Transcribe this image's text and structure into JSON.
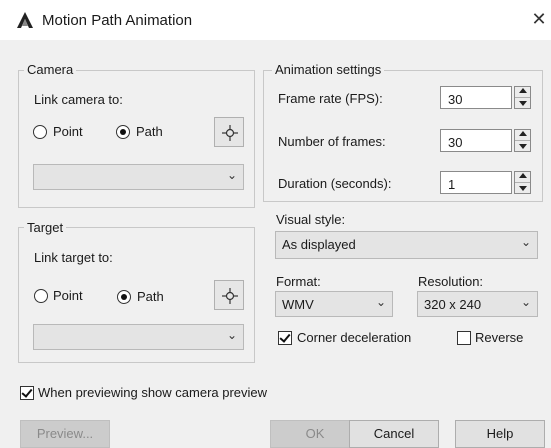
{
  "window": {
    "title": "Motion Path Animation",
    "close_glyph": "✕",
    "app_icon": "autocad-a-icon"
  },
  "camera": {
    "legend": "Camera",
    "link_label": "Link camera to:",
    "options": [
      "Point",
      "Path"
    ],
    "selected": "Path",
    "dropdown_value": ""
  },
  "target": {
    "legend": "Target",
    "link_label": "Link target to:",
    "options": [
      "Point",
      "Path"
    ],
    "selected": "Path",
    "dropdown_value": ""
  },
  "animation": {
    "legend": "Animation settings",
    "frame_rate_label": "Frame rate (FPS):",
    "frame_rate": "30",
    "frames_label": "Number of frames:",
    "frames": "30",
    "duration_label": "Duration (seconds):",
    "duration": "1",
    "visual_style_label": "Visual style:",
    "visual_style": "As displayed",
    "format_label": "Format:",
    "format": "WMV",
    "resolution_label": "Resolution:",
    "resolution": "320 x 240",
    "corner_decel_label": "Corner deceleration",
    "corner_decel_checked": true,
    "reverse_label": "Reverse",
    "reverse_checked": false
  },
  "preview_checkbox": {
    "label": "When previewing show camera preview",
    "checked": true
  },
  "buttons": {
    "preview": "Preview...",
    "ok": "OK",
    "cancel": "Cancel",
    "help": "Help"
  },
  "icons": {
    "chevron": "chevron-down-icon",
    "pick": "pick-point-icon"
  }
}
